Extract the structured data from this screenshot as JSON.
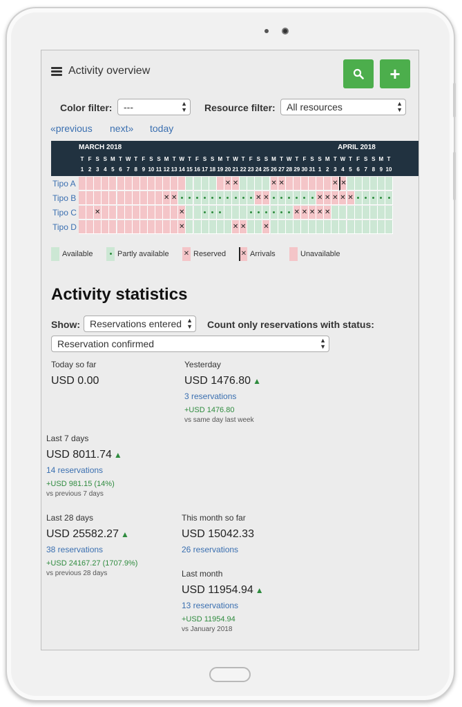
{
  "header": {
    "title": "Activity overview"
  },
  "filters": {
    "color_label": "Color filter:",
    "color_value": "---",
    "resource_label": "Resource filter:",
    "resource_value": "All resources"
  },
  "nav": {
    "previous": "«previous",
    "next": "next»",
    "today": "today"
  },
  "calendar": {
    "months": [
      "MARCH 2018",
      "APRIL 2018"
    ],
    "weekdays": [
      "T",
      "F",
      "S",
      "S",
      "M",
      "T",
      "W",
      "T",
      "F",
      "S",
      "S",
      "M",
      "T",
      "W",
      "T",
      "F",
      "S",
      "S",
      "M",
      "T",
      "W",
      "T",
      "F",
      "S",
      "S",
      "M",
      "T",
      "W",
      "T",
      "F",
      "S",
      "S",
      "M",
      "T",
      "W",
      "T",
      "F",
      "S",
      "S",
      "M",
      "T"
    ],
    "daynums": [
      "1",
      "2",
      "3",
      "4",
      "5",
      "6",
      "7",
      "8",
      "9",
      "10",
      "11",
      "12",
      "13",
      "14",
      "15",
      "16",
      "17",
      "18",
      "19",
      "20",
      "21",
      "22",
      "23",
      "24",
      "25",
      "26",
      "27",
      "28",
      "29",
      "30",
      "31",
      "1",
      "2",
      "3",
      "4",
      "5",
      "6",
      "7",
      "8",
      "9",
      "10"
    ],
    "rows": [
      {
        "name": "Tipo A",
        "cells": "UUUUUUUUUUUUUUAAAAUXXAAAAXXUUUUUUXXAAAAAAA",
        "arrival_index": 34
      },
      {
        "name": "Tipo B",
        "cells": "UUUUUUUUUUUXXPPPPPPPPPPXXPPPPPPXXXXXPPPPPPPPP"
      },
      {
        "name": "Tipo C",
        "cells": "UUXUUUUUUUUUUXAAPPPAAAPPPPPPXXXXXAAAAAAAAA"
      },
      {
        "name": "Tipo D",
        "cells": "UUUUUUUUUUUUUXAAAAAAXXAAXAAAAAAAAAAAAAAAAA"
      }
    ]
  },
  "legend": {
    "available": "Available",
    "partly": "Partly available",
    "reserved": "Reserved",
    "arrivals": "Arrivals",
    "unavailable": "Unavailable"
  },
  "stats": {
    "title": "Activity statistics",
    "show_label": "Show:",
    "show_value": "Reservations entered",
    "status_label": "Count only reservations with status:",
    "status_value": "Reservation confirmed",
    "today": {
      "label": "Today so far",
      "value": "USD 0.00"
    },
    "yesterday": {
      "label": "Yesterday",
      "value": "USD 1476.80",
      "link": "3 reservations",
      "delta": "+USD 1476.80",
      "vs": "vs same day last week"
    },
    "last7": {
      "label": "Last 7 days",
      "value": "USD 8011.74",
      "link": "14 reservations",
      "delta": "+USD 981.15 (14%)",
      "vs": "vs previous 7 days"
    },
    "last28": {
      "label": "Last 28 days",
      "value": "USD 25582.27",
      "link": "38 reservations",
      "delta": "+USD 24167.27 (1707.9%)",
      "vs": "vs previous 28 days"
    },
    "month": {
      "label": "This month so far",
      "value": "USD 15042.33",
      "link": "26 reservations"
    },
    "lastmonth": {
      "label": "Last month",
      "value": "USD 11954.94",
      "link": "13 reservations",
      "delta": "+USD 11954.94",
      "vs": "vs January 2018"
    }
  },
  "colors": {
    "accent": "#4cae4c",
    "link": "#3a6fb0",
    "available": "#cce7d4",
    "unavailable": "#f4c5c8",
    "header": "#213240"
  }
}
